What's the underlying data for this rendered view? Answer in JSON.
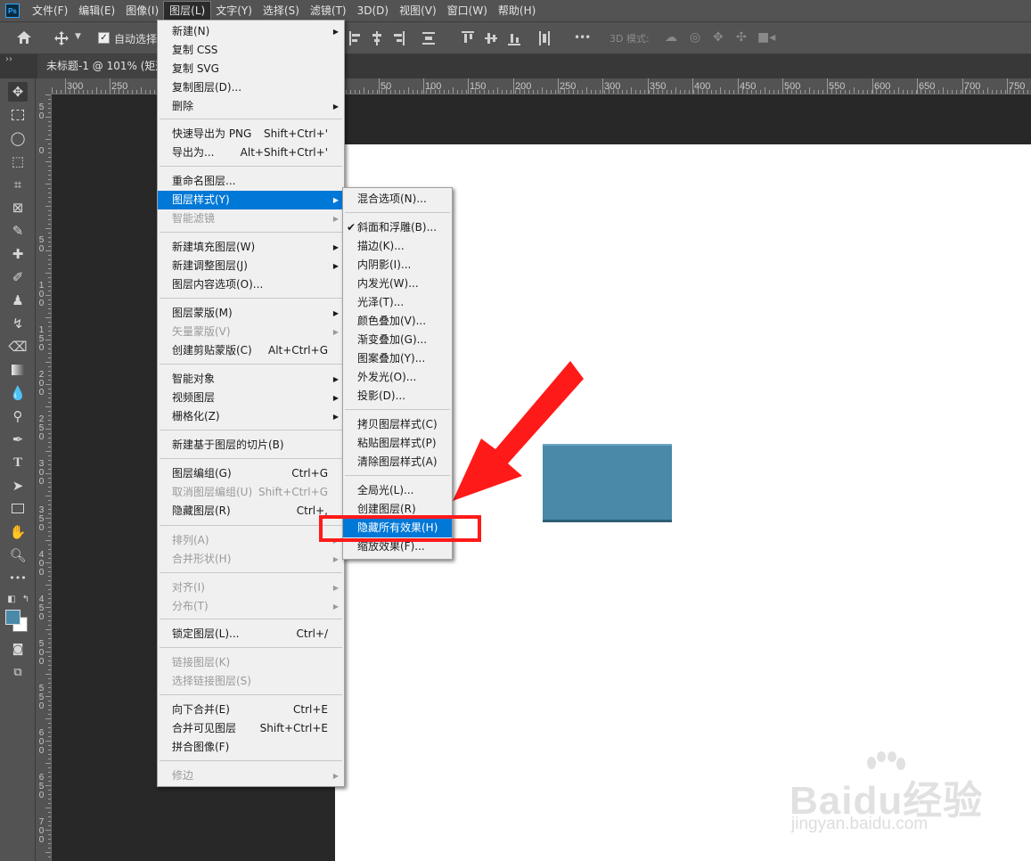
{
  "menubar": {
    "logo": "Ps",
    "items": [
      "文件(F)",
      "编辑(E)",
      "图像(I)",
      "图层(L)",
      "文字(Y)",
      "选择(S)",
      "滤镜(T)",
      "3D(D)",
      "视图(V)",
      "窗口(W)",
      "帮助(H)"
    ],
    "active_item": "图层(L)"
  },
  "options": {
    "autoselect_label": "自动选择",
    "autoselect_checked": "✓",
    "mode_3d_label": "3D 模式:",
    "more_glyph": "•••"
  },
  "document_tab": {
    "title": "未标题-1 @ 101% (矩形",
    "collapse_glyph": "››"
  },
  "ruler_top_labels": [
    "300",
    "250",
    "50",
    "100",
    "150",
    "200",
    "250",
    "300",
    "350",
    "400",
    "450",
    "500",
    "550",
    "600",
    "650",
    "700",
    "750"
  ],
  "ruler_left_labels": [
    "5 0",
    "0",
    "5 0",
    "1 0 0",
    "1 5 0",
    "2 0 0",
    "2 5 0",
    "3 0 0",
    "3 5 0",
    "4 0 0",
    "4 5 0",
    "5 0 0",
    "5 5 0",
    "6 0 0",
    "6 5 0",
    "7 0 0",
    "7 5 0"
  ],
  "layer_menu": {
    "items": [
      {
        "label": "新建(N)",
        "shortcut": "",
        "submenu": true,
        "disabled": false
      },
      {
        "label": "复制 CSS",
        "shortcut": "",
        "submenu": false,
        "disabled": false
      },
      {
        "label": "复制 SVG",
        "shortcut": "",
        "submenu": false,
        "disabled": false
      },
      {
        "label": "复制图层(D)...",
        "shortcut": "",
        "submenu": false,
        "disabled": false
      },
      {
        "label": "删除",
        "shortcut": "",
        "submenu": true,
        "disabled": false
      },
      {
        "label": "快速导出为 PNG",
        "shortcut": "Shift+Ctrl+'",
        "submenu": false,
        "disabled": false
      },
      {
        "label": "导出为...",
        "shortcut": "Alt+Shift+Ctrl+'",
        "submenu": false,
        "disabled": false
      },
      {
        "label": "重命名图层...",
        "shortcut": "",
        "submenu": false,
        "disabled": false
      },
      {
        "label": "图层样式(Y)",
        "shortcut": "",
        "submenu": true,
        "disabled": false
      },
      {
        "label": "智能滤镜",
        "shortcut": "",
        "submenu": true,
        "disabled": true
      },
      {
        "label": "新建填充图层(W)",
        "shortcut": "",
        "submenu": true,
        "disabled": false
      },
      {
        "label": "新建调整图层(J)",
        "shortcut": "",
        "submenu": true,
        "disabled": false
      },
      {
        "label": "图层内容选项(O)...",
        "shortcut": "",
        "submenu": false,
        "disabled": false
      },
      {
        "label": "图层蒙版(M)",
        "shortcut": "",
        "submenu": true,
        "disabled": false
      },
      {
        "label": "矢量蒙版(V)",
        "shortcut": "",
        "submenu": true,
        "disabled": true
      },
      {
        "label": "创建剪贴蒙版(C)",
        "shortcut": "Alt+Ctrl+G",
        "submenu": false,
        "disabled": false
      },
      {
        "label": "智能对象",
        "shortcut": "",
        "submenu": true,
        "disabled": false
      },
      {
        "label": "视频图层",
        "shortcut": "",
        "submenu": true,
        "disabled": false
      },
      {
        "label": "栅格化(Z)",
        "shortcut": "",
        "submenu": true,
        "disabled": false
      },
      {
        "label": "新建基于图层的切片(B)",
        "shortcut": "",
        "submenu": false,
        "disabled": false
      },
      {
        "label": "图层编组(G)",
        "shortcut": "Ctrl+G",
        "submenu": false,
        "disabled": false
      },
      {
        "label": "取消图层编组(U)",
        "shortcut": "Shift+Ctrl+G",
        "submenu": false,
        "disabled": true
      },
      {
        "label": "隐藏图层(R)",
        "shortcut": "Ctrl+,",
        "submenu": false,
        "disabled": false
      },
      {
        "label": "排列(A)",
        "shortcut": "",
        "submenu": true,
        "disabled": true
      },
      {
        "label": "合并形状(H)",
        "shortcut": "",
        "submenu": true,
        "disabled": true
      },
      {
        "label": "对齐(I)",
        "shortcut": "",
        "submenu": true,
        "disabled": true
      },
      {
        "label": "分布(T)",
        "shortcut": "",
        "submenu": true,
        "disabled": true
      },
      {
        "label": "锁定图层(L)...",
        "shortcut": "Ctrl+/",
        "submenu": false,
        "disabled": false
      },
      {
        "label": "链接图层(K)",
        "shortcut": "",
        "submenu": false,
        "disabled": true
      },
      {
        "label": "选择链接图层(S)",
        "shortcut": "",
        "submenu": false,
        "disabled": true
      },
      {
        "label": "向下合并(E)",
        "shortcut": "Ctrl+E",
        "submenu": false,
        "disabled": false
      },
      {
        "label": "合并可见图层",
        "shortcut": "Shift+Ctrl+E",
        "submenu": false,
        "disabled": false
      },
      {
        "label": "拼合图像(F)",
        "shortcut": "",
        "submenu": false,
        "disabled": false
      },
      {
        "label": "修边",
        "shortcut": "",
        "submenu": true,
        "disabled": true
      }
    ],
    "highlighted": "图层样式(Y)"
  },
  "style_submenu": {
    "items": [
      {
        "label": "混合选项(N)...",
        "checked": false
      },
      {
        "label": "斜面和浮雕(B)...",
        "checked": true
      },
      {
        "label": "描边(K)...",
        "checked": false
      },
      {
        "label": "内阴影(I)...",
        "checked": false
      },
      {
        "label": "内发光(W)...",
        "checked": false
      },
      {
        "label": "光泽(T)...",
        "checked": false
      },
      {
        "label": "颜色叠加(V)...",
        "checked": false
      },
      {
        "label": "渐变叠加(G)...",
        "checked": false
      },
      {
        "label": "图案叠加(Y)...",
        "checked": false
      },
      {
        "label": "外发光(O)...",
        "checked": false
      },
      {
        "label": "投影(D)...",
        "checked": false
      },
      {
        "label": "拷贝图层样式(C)",
        "checked": false
      },
      {
        "label": "粘贴图层样式(P)",
        "checked": false
      },
      {
        "label": "清除图层样式(A)",
        "checked": false
      },
      {
        "label": "全局光(L)...",
        "checked": false
      },
      {
        "label": "创建图层(R)",
        "checked": false
      },
      {
        "label": "隐藏所有效果(H)",
        "checked": false
      },
      {
        "label": "缩放效果(F)...",
        "checked": false
      }
    ],
    "highlighted": "隐藏所有效果(H)",
    "check_glyph": "✔"
  },
  "colors": {
    "foreground": "#4a89a8",
    "background": "#ffffff",
    "shape_fill": "#4a89a8",
    "annotation_red": "#ff1a1a",
    "menu_highlight": "#0078d7"
  },
  "watermark": {
    "brand": "Baidu经验",
    "url": "jingyan.baidu.com"
  }
}
